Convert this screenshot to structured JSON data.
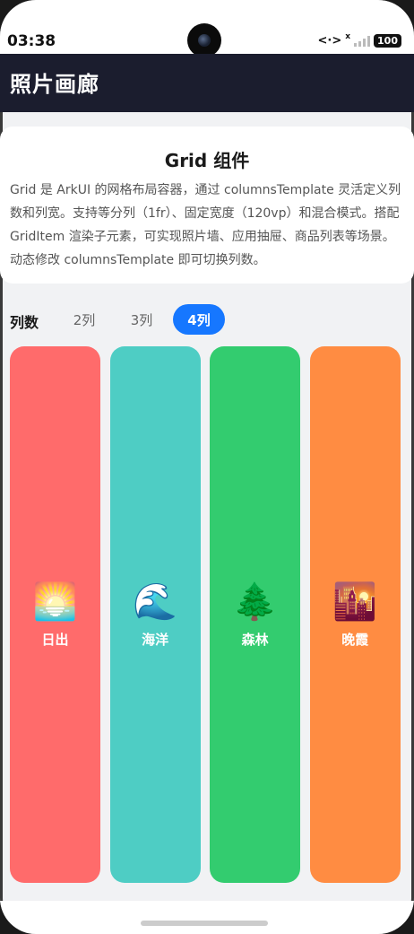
{
  "status": {
    "time": "03:38",
    "net_icon": "<·>",
    "signal_x": "x",
    "battery": "100"
  },
  "app": {
    "title": "照片画廊"
  },
  "info": {
    "title": "Grid 组件",
    "description": "Grid 是 ArkUI 的网格布局容器，通过 columnsTemplate 灵活定义列数和列宽。支持等分列（1fr）、固定宽度（120vp）和混合模式。搭配 GridItem 渲染子元素，可实现照片墙、应用抽屉、商品列表等场景。动态修改 columnsTemplate 即可切换列数。"
  },
  "columns": {
    "label": "列数",
    "options": [
      "2列",
      "3列",
      "4列"
    ],
    "selected": "4列"
  },
  "photos": [
    {
      "emoji": "🌅",
      "icon": "sunrise-icon",
      "label": "日出",
      "color": "#ff6b6b"
    },
    {
      "emoji": "🌊",
      "icon": "wave-icon",
      "label": "海洋",
      "color": "#4ecdc4"
    },
    {
      "emoji": "🌲",
      "icon": "tree-icon",
      "label": "森林",
      "color": "#33cc6f"
    },
    {
      "emoji": "🌇",
      "icon": "sunset-icon",
      "label": "晚霞",
      "color": "#ff8c42"
    }
  ],
  "colors": {
    "appbar": "#1b1d2e",
    "accent": "#1677ff",
    "background": "#f1f2f4"
  }
}
